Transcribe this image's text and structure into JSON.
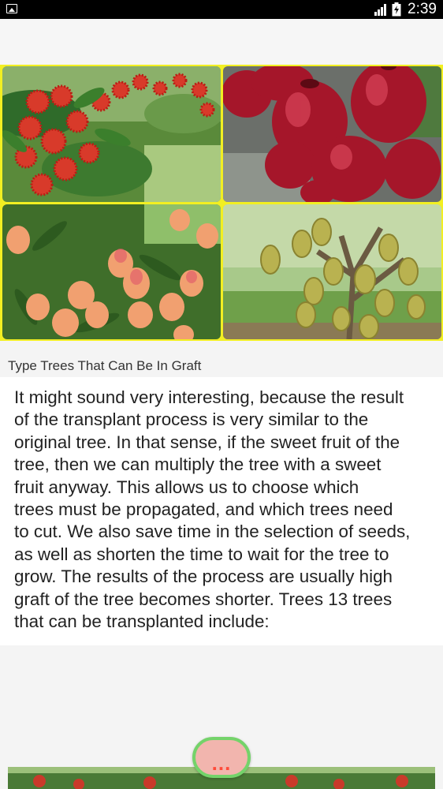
{
  "status_bar": {
    "time": "2:39",
    "left_icon": "image-notification-icon",
    "signal_icon": "cell-signal-icon",
    "battery_icon": "battery-charging-icon"
  },
  "collage": {
    "border_color": "#f2ef22",
    "tiles": [
      {
        "subject": "rambutan-tree"
      },
      {
        "subject": "rose-apple-fruit"
      },
      {
        "subject": "mango-tree"
      },
      {
        "subject": "durian-tree"
      }
    ]
  },
  "article": {
    "caption": "Type Trees That Can Be In Graft",
    "lines": [
      "It might sound very interesting, because the result",
      "of the transplant process is very similar to the",
      "original tree. In that sense, if the sweet fruit of the",
      "tree, then we can multiply the tree with a sweet",
      "fruit anyway. This allows us to choose which",
      "trees must be propagated, and which trees need",
      "to cut. We also save time in the selection of seeds,",
      "as well as shorten the time to wait for the tree to",
      "grow. The results of the process are usually high",
      "graft of the tree becomes shorter. Trees 13 trees",
      "that can be transplanted include:"
    ]
  },
  "more_button": {
    "label": "...",
    "fill_color": "#f2b5ae",
    "ring_color": "#74d36a"
  }
}
